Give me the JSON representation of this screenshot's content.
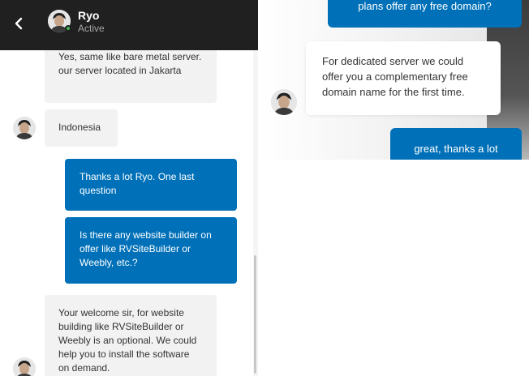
{
  "header": {
    "contact_name": "Ryo",
    "status": "Active"
  },
  "messages": [
    {
      "from": "agent",
      "text": "Yes, same like bare metal server.\nour server located in Jakarta"
    },
    {
      "from": "agent",
      "text": "Indonesia"
    },
    {
      "from": "user",
      "text": "Thanks a lot Ryo. One last question"
    },
    {
      "from": "user",
      "text": "Is there any website builder on offer like RVSiteBuilder or Weebly, etc.?"
    },
    {
      "from": "agent",
      "text": "Your welcome sir, for website building like RVSiteBuilder or Weebly is an optional. We could help you to install the software on demand."
    }
  ],
  "right_panel": {
    "user_message_top": "plans offer any free domain?",
    "agent_message": "For dedicated server we could offer you a complementary free domain name for the first time.",
    "user_message_bottom": "great, thanks a lot"
  },
  "colors": {
    "header_bg": "#202020",
    "outgoing_bubble": "#0070b8",
    "incoming_bubble": "#f2f2f2",
    "online_indicator": "#3fb950"
  },
  "icons": {
    "back": "chevron-left-icon",
    "online": "status-dot-icon"
  }
}
